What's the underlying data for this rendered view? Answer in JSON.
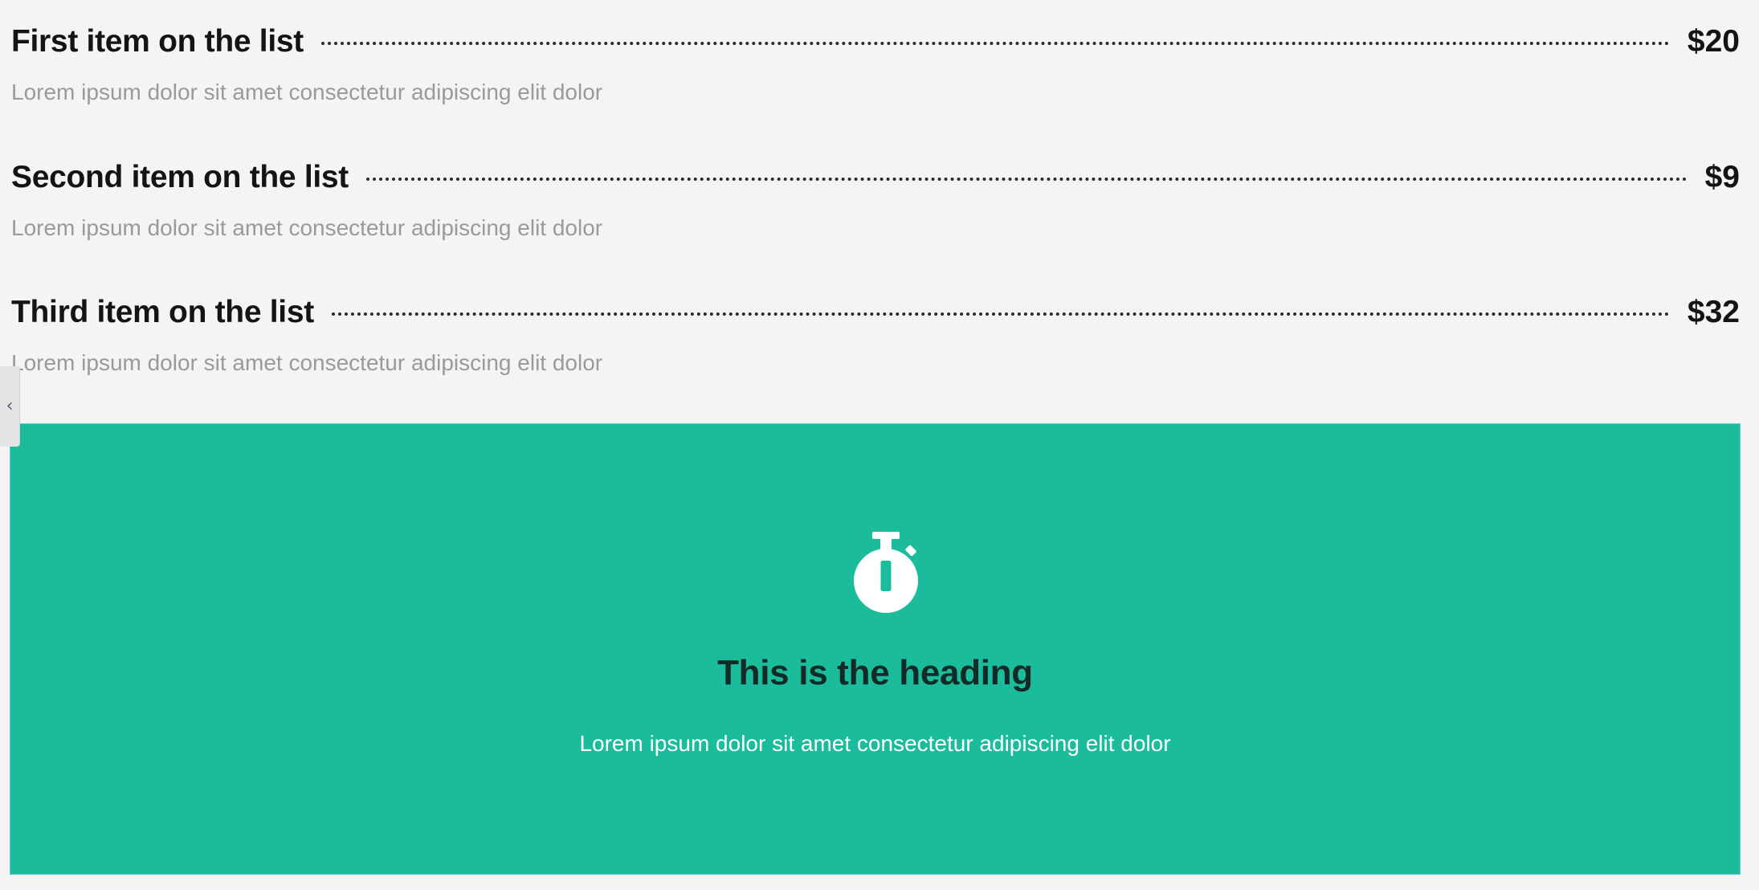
{
  "price_list": {
    "items": [
      {
        "title": "First item on the list",
        "price": "$20",
        "description": "Lorem ipsum dolor sit amet consectetur adipiscing elit dolor"
      },
      {
        "title": "Second item on the list",
        "price": "$9",
        "description": "Lorem ipsum dolor sit amet consectetur adipiscing elit dolor"
      },
      {
        "title": "Third item on the list",
        "price": "$32",
        "description": "Lorem ipsum dolor sit amet consectetur adipiscing elit dolor"
      }
    ]
  },
  "sidebar_toggle": {
    "icon": "chevron-left-icon"
  },
  "feature_box": {
    "icon": "stopwatch-icon",
    "heading": "This is the heading",
    "text": "Lorem ipsum dolor sit amet consectetur adipiscing elit dolor",
    "background_color": "#1abc9c"
  }
}
